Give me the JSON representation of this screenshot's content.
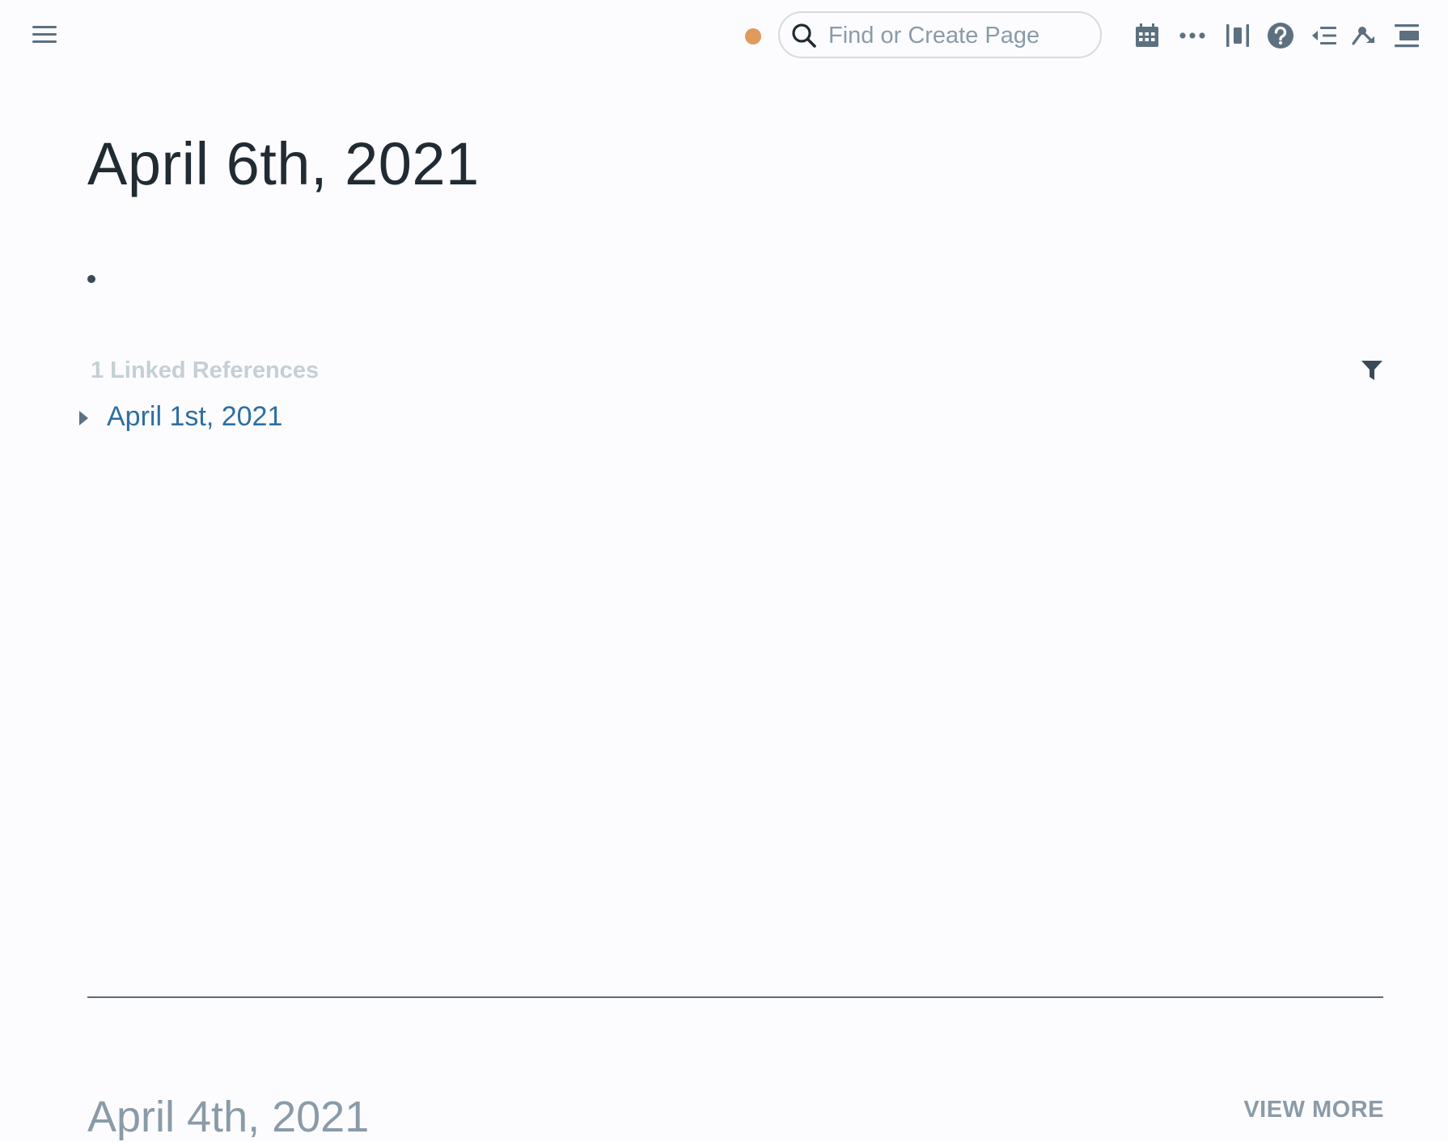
{
  "topbar": {
    "menu_icon": "hamburger-menu-icon",
    "status_color": "#e09a5c",
    "search": {
      "placeholder": "Find or Create Page",
      "value": ""
    },
    "icons": [
      "calendar-icon",
      "more-horizontal-icon",
      "columns-icon",
      "help-icon",
      "outdent-list-icon",
      "graph-icon",
      "sidebar-toggle-icon"
    ]
  },
  "page": {
    "title": "April 6th, 2021",
    "blocks": [
      ""
    ],
    "linked_references": {
      "header": "1 Linked References",
      "items": [
        {
          "label": "April 1st, 2021"
        }
      ]
    }
  },
  "next_page": {
    "title": "April 4th, 2021",
    "view_more_label": "VIEW MORE"
  },
  "colors": {
    "background": "#fcfcfe",
    "link": "#2d6ea3",
    "muted": "#8a9ba8",
    "status_dot": "#e09a5c"
  }
}
